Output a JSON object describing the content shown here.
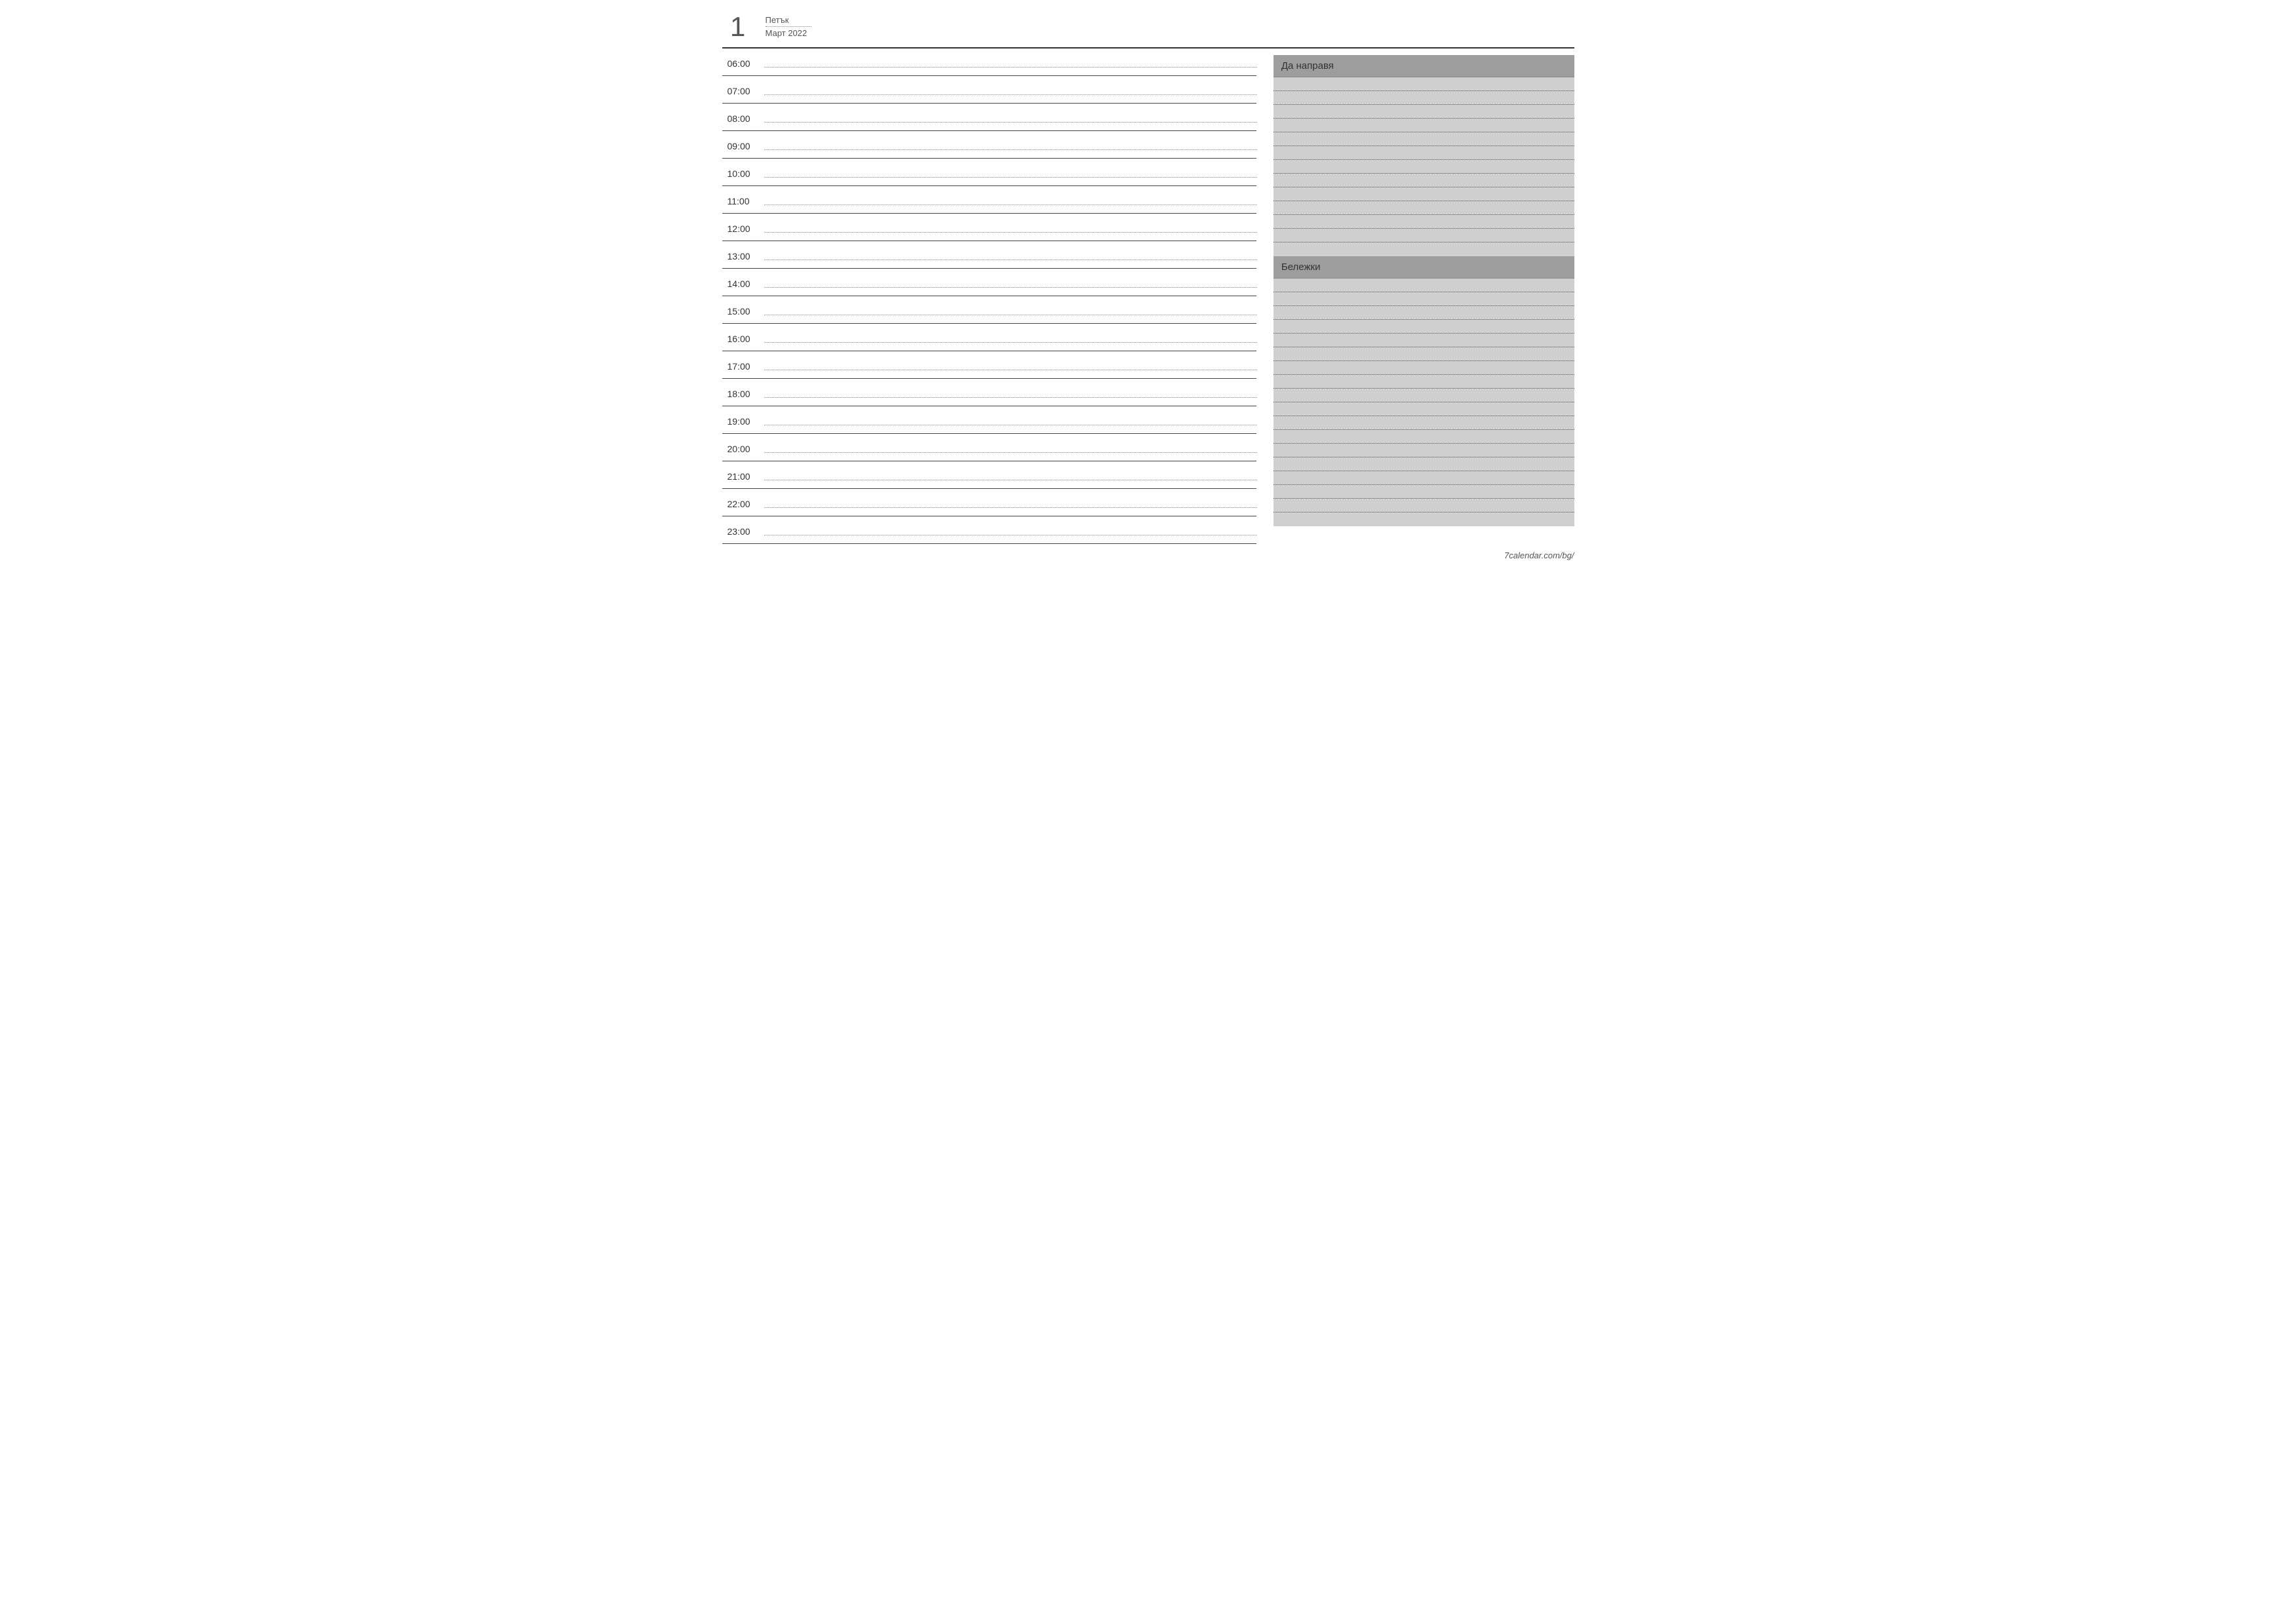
{
  "header": {
    "day_number": "1",
    "weekday": "Петък",
    "month_year": "Март 2022"
  },
  "schedule": {
    "hours": [
      "06:00",
      "07:00",
      "08:00",
      "09:00",
      "10:00",
      "11:00",
      "12:00",
      "13:00",
      "14:00",
      "15:00",
      "16:00",
      "17:00",
      "18:00",
      "19:00",
      "20:00",
      "21:00",
      "22:00",
      "23:00"
    ]
  },
  "sidebar": {
    "todo": {
      "title": "Да направя",
      "line_count": 13
    },
    "notes": {
      "title": "Бележки",
      "line_count": 18
    }
  },
  "footer": {
    "source": "7calendar.com/bg/"
  }
}
